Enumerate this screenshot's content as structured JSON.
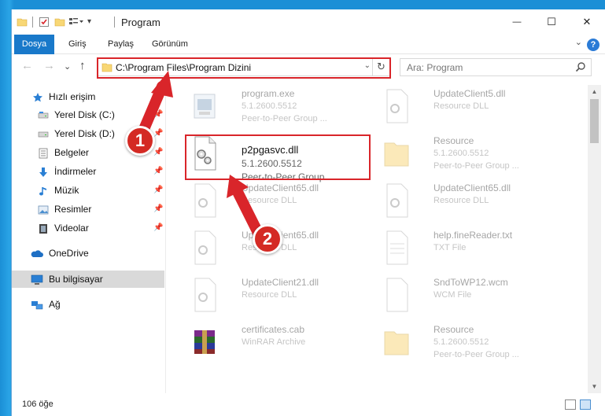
{
  "window": {
    "title": "Program",
    "minimize_glyph": "—",
    "maximize_glyph": "☐",
    "close_glyph": "✕"
  },
  "ribbon": {
    "tabs": [
      "Dosya",
      "Giriş",
      "Paylaş",
      "Görünüm"
    ],
    "help": "?",
    "collapse": "⌄"
  },
  "address": {
    "path": "C:\\Program Files\\Program Dizini",
    "dropdown": "⌄",
    "refresh": "↻"
  },
  "nav_buttons": {
    "back": "←",
    "forward": "→",
    "recent": "⌄",
    "up": "↑"
  },
  "search": {
    "placeholder": "Ara: Program"
  },
  "sidebar": {
    "items": [
      {
        "label": "Hızlı erişim",
        "icon": "star-icon",
        "pinned": false
      },
      {
        "label": "Yerel Disk (C:)",
        "icon": "drive-icon",
        "pinned": true
      },
      {
        "label": "Yerel Disk (D:)",
        "icon": "drive-icon",
        "pinned": true
      },
      {
        "label": "Belgeler",
        "icon": "documents-icon",
        "pinned": true
      },
      {
        "label": "İndirmeler",
        "icon": "download-icon",
        "pinned": true
      },
      {
        "label": "Müzik",
        "icon": "music-icon",
        "pinned": true
      },
      {
        "label": "Resimler",
        "icon": "pictures-icon",
        "pinned": true
      },
      {
        "label": "Videolar",
        "icon": "video-icon",
        "pinned": true
      },
      {
        "label": "OneDrive",
        "icon": "cloud-icon",
        "pinned": false
      },
      {
        "label": "Bu bilgisayar",
        "icon": "computer-icon",
        "pinned": false,
        "selected": true
      },
      {
        "label": "Ağ",
        "icon": "network-icon",
        "pinned": false
      }
    ],
    "pin_glyph": "📌"
  },
  "files": [
    {
      "name": "program.exe",
      "version": "5.1.2600.5512",
      "desc": "Peer-to-Peer Group ...",
      "icon": "exe-icon",
      "faded": true
    },
    {
      "name": "UpdateClient5.dll",
      "version": "Resource DLL",
      "desc": "",
      "icon": "dll-icon",
      "faded": true
    },
    {
      "name": "p2pgasvc.dll",
      "version": "5.1.2600.5512",
      "desc": "Peer-to-Peer Group ...",
      "icon": "dll-gear-icon",
      "faded": false,
      "highlighted": true
    },
    {
      "name": "Resource",
      "version": "5.1.2600.5512",
      "desc": "Peer-to-Peer Group ...",
      "icon": "folder-icon",
      "faded": true
    },
    {
      "name": "UpdateClient65.dll",
      "version": "Resource DLL",
      "desc": "",
      "icon": "dll-icon",
      "faded": true
    },
    {
      "name": "UpdateClient65.dll",
      "version": "Resource DLL",
      "desc": "",
      "icon": "dll-icon",
      "faded": true
    },
    {
      "name": "UpdateClient65.dll",
      "version": "Resource DLL",
      "desc": "",
      "icon": "dll-icon",
      "faded": true
    },
    {
      "name": "help.fineReader.txt",
      "version": "TXT File",
      "desc": "",
      "icon": "txt-icon",
      "faded": true
    },
    {
      "name": "UpdateClient21.dll",
      "version": "Resource DLL",
      "desc": "",
      "icon": "dll-icon",
      "faded": true
    },
    {
      "name": "SndToWP12.wcm",
      "version": "WCM File",
      "desc": "",
      "icon": "file-icon",
      "faded": true
    },
    {
      "name": "certificates.cab",
      "version": "WinRAR Archive",
      "desc": "",
      "icon": "winrar-icon",
      "faded": true
    },
    {
      "name": "Resource",
      "version": "5.1.2600.5512",
      "desc": "Peer-to-Peer Group ...",
      "icon": "folder-icon",
      "faded": true
    }
  ],
  "annotations": {
    "badge1": "1",
    "badge2": "2",
    "color": "#d9252a"
  },
  "status": {
    "count": "106 öğe"
  }
}
